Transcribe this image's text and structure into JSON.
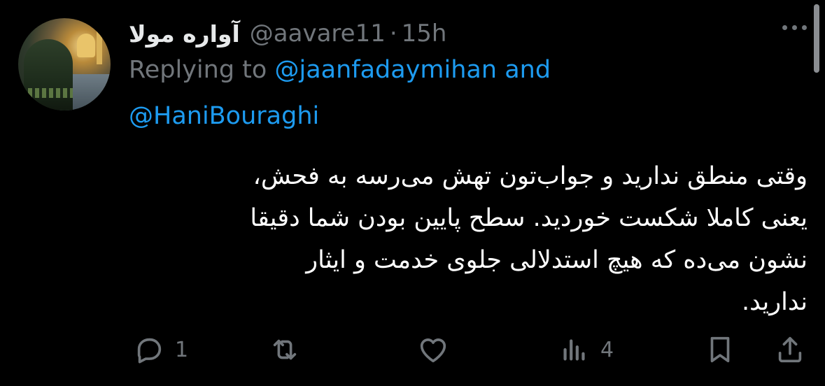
{
  "tweet": {
    "display_name": "آواره مولا",
    "handle": "@aavare11",
    "separator": "·",
    "time": "15h",
    "replying_prefix": "Replying to",
    "replying_mention_1": "@jaanfadaymihan",
    "replying_and": "and",
    "replying_mention_2": "@HaniBouraghi",
    "text": "وقتی منطق ندارید و جواب‌تون تهش می‌رسه به فحش،\nیعنی کاملا شکست خوردید. سطح پایین بودن شما دقیقا\nنشون می‌ده که هیچ استدلالی جلوی خدمت و ایثار\nندارید."
  },
  "actions": {
    "reply_count": "1",
    "retweet_count": "",
    "like_count": "",
    "views_count": "4"
  },
  "icons": {
    "avatar": "avatar-shrine-photo",
    "more": "more-horizontal-icon",
    "reply": "reply-icon",
    "retweet": "retweet-icon",
    "like": "heart-icon",
    "views": "views-chart-icon",
    "bookmark": "bookmark-icon",
    "share": "share-icon"
  },
  "colors": {
    "background": "#000000",
    "text": "#e7e9ea",
    "secondary": "#71767b",
    "accent": "#1d9bf0"
  }
}
